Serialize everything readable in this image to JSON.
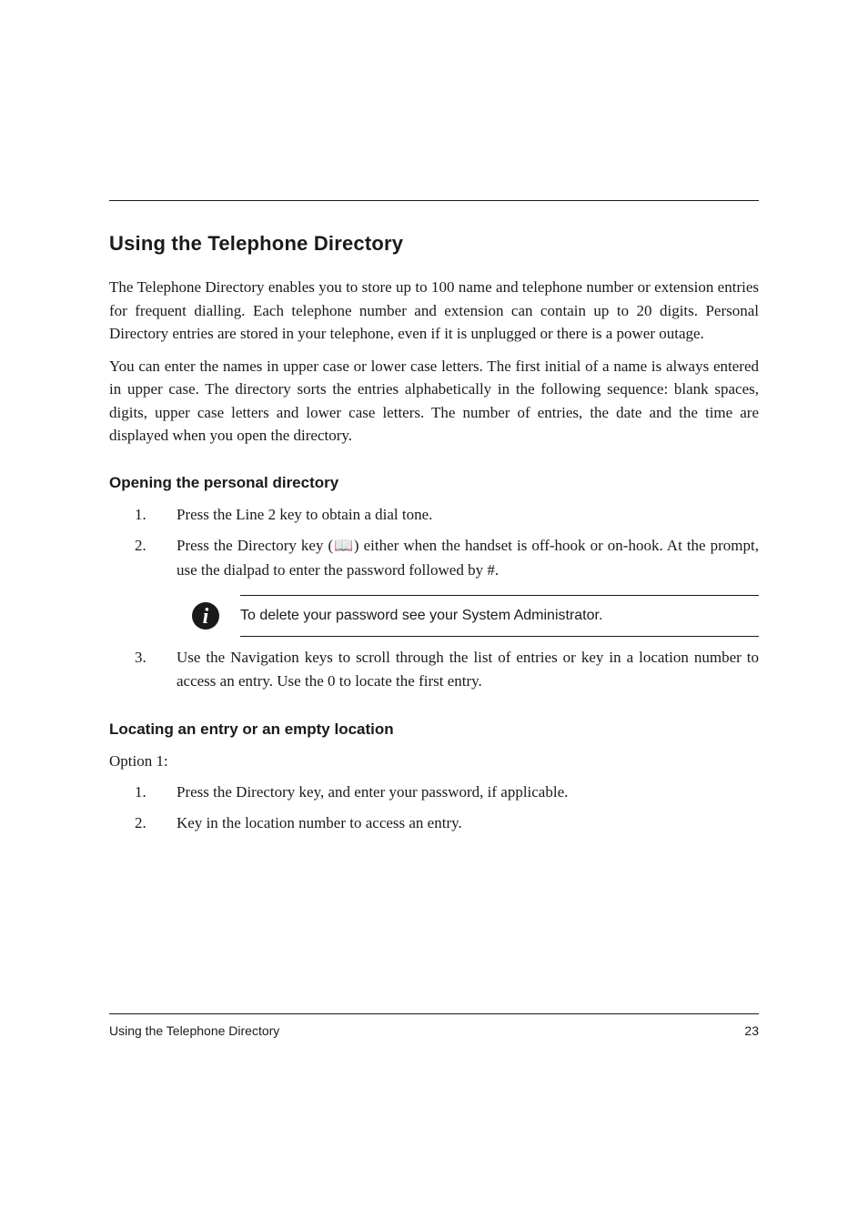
{
  "section_title": "Using the Telephone Directory",
  "intro_paragraphs": [
    "The Telephone Directory enables you to store up to 100 name and telephone number or extension entries for frequent dialling. Each telephone number and extension can contain up to 20 digits. Personal Directory entries are stored in your telephone, even if it is unplugged or there is a power outage.",
    "You can enter the names in upper case or lower case letters. The first initial of a name is always entered in upper case. The directory sorts the entries alphabetically in the following sequence: blank spaces, digits, upper case letters and lower case letters. The number of entries, the date and the time are displayed when you open the directory."
  ],
  "subhead": "Opening the personal directory",
  "steps": [
    {
      "num": "1.",
      "text": "Press the Line 2 key to obtain a dial tone."
    },
    {
      "num": "2.",
      "text": "Press the Directory key (📖) either when the handset is off-hook or on-hook. At the prompt, use the dialpad to enter the password followed by #."
    }
  ],
  "note_text": "To delete your password see your System Administrator.",
  "after_steps": [
    {
      "num": "3.",
      "text": "Use the Navigation keys to scroll through the list of entries or key in a location number to access an entry. Use the 0 to locate the first entry."
    }
  ],
  "subhead2": "Locating an entry or an empty location",
  "subhead2_intro": "Option 1:",
  "steps2": [
    {
      "num": "1.",
      "text": "Press the Directory key, and enter your password, if applicable."
    },
    {
      "num": "2.",
      "text": "Key in the location number to access an entry."
    }
  ],
  "footer": {
    "left": "Using the Telephone Directory",
    "right": "23"
  }
}
